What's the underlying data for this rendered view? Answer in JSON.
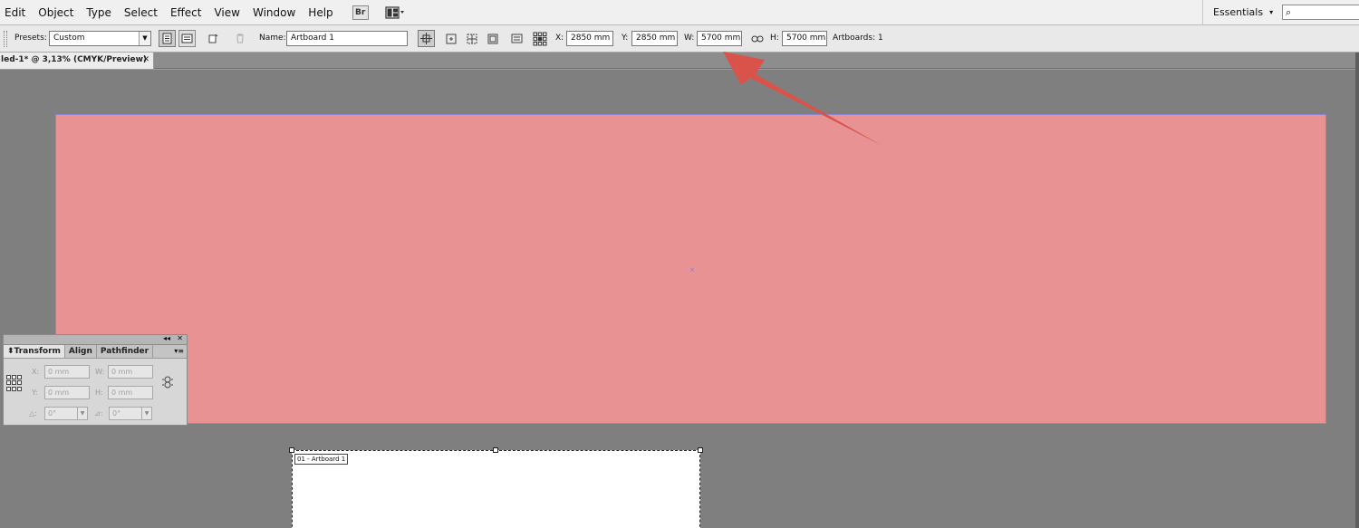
{
  "menubar": {
    "items": [
      "Edit",
      "Object",
      "Type",
      "Select",
      "Effect",
      "View",
      "Window",
      "Help"
    ],
    "bridge_label": "Br",
    "workspace_label": "Essentials",
    "workspace_caret": "▾",
    "search_glyph": "⌕"
  },
  "controlbar": {
    "presets_label": "Presets:",
    "presets_value": "Custom",
    "name_label": "Name:",
    "name_value": "Artboard 1",
    "x_label": "X:",
    "x_value": "2850 mm",
    "y_label": "Y:",
    "y_value": "2850 mm",
    "w_label": "W:",
    "w_value": "5700 mm",
    "h_label": "H:",
    "h_value": "5700 mm",
    "artboards_text": "Artboards: 1"
  },
  "document": {
    "tab_title": "led-1* @ 3,13% (CMYK/Preview)",
    "close_glyph": "✕",
    "artboard_label": "01 - Artboard 1",
    "center_mark": "×"
  },
  "transform_panel": {
    "tabs": [
      "Transform",
      "Align",
      "Pathfinder"
    ],
    "active_tab": "Transform",
    "collapse_glyph": "◂◂",
    "close_glyph": "✕",
    "menu_glyph": "▾≡",
    "x_label": "X:",
    "x_value": "0 mm",
    "y_label": "Y:",
    "y_value": "0 mm",
    "w_label": "W:",
    "w_value": "0 mm",
    "h_label": "H:",
    "h_value": "0 mm",
    "rotate_label": "△:",
    "rotate_value": "0°",
    "shear_label": "⊿:",
    "shear_value": "0°"
  },
  "colors": {
    "canvas": "#7f7f7f",
    "artboard_fill": "#e99294",
    "artboard_border": "#8f86cc",
    "annotation_arrow": "#d9534a"
  },
  "icons": {
    "arrange_documents": "layout-grid-icon",
    "link_proportions": "chain-link-icon"
  }
}
